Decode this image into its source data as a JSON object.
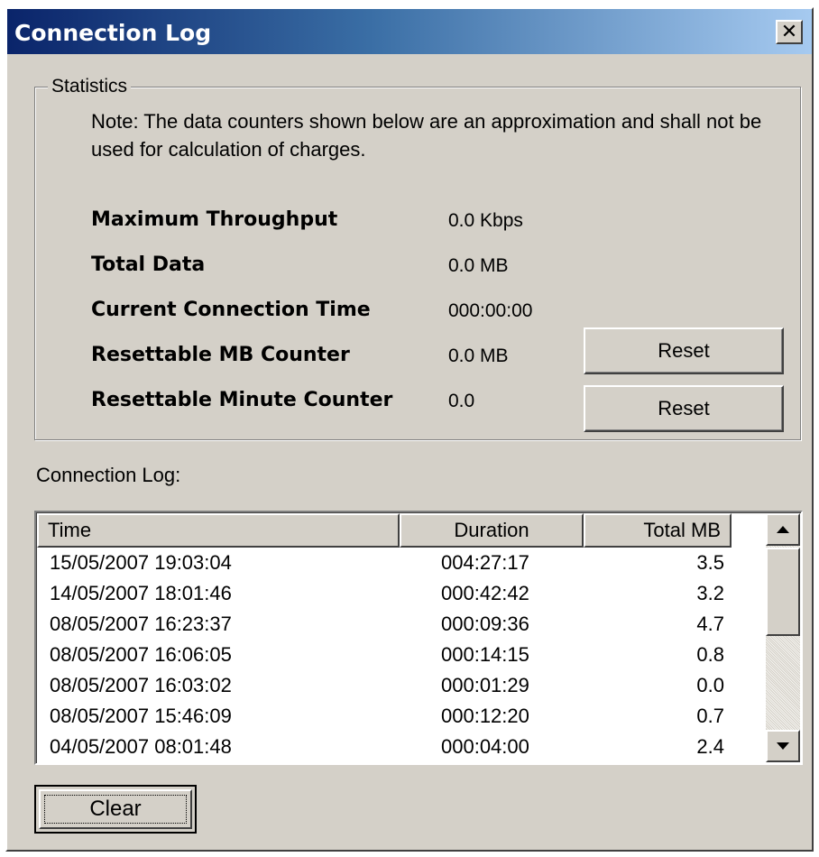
{
  "window": {
    "title": "Connection Log",
    "close_label": "✕"
  },
  "statistics": {
    "legend": "Statistics",
    "note": "Note: The data counters shown below are an approximation and shall not be used for calculation of charges.",
    "rows": [
      {
        "label": "Maximum Throughput",
        "value": "0.0 Kbps"
      },
      {
        "label": "Total Data",
        "value": "0.0 MB"
      },
      {
        "label": "Current Connection Time",
        "value": "000:00:00"
      },
      {
        "label": "Resettable MB Counter",
        "value": "0.0 MB"
      },
      {
        "label": "Resettable Minute Counter",
        "value": "0.0"
      }
    ],
    "reset_label": "Reset"
  },
  "log": {
    "label": "Connection Log:",
    "columns": [
      "Time",
      "Duration",
      "Total MB"
    ],
    "rows": [
      [
        "15/05/2007 19:03:04",
        "004:27:17",
        "3.5"
      ],
      [
        "14/05/2007 18:01:46",
        "000:42:42",
        "3.2"
      ],
      [
        "08/05/2007 16:23:37",
        "000:09:36",
        "4.7"
      ],
      [
        "08/05/2007 16:06:05",
        "000:14:15",
        "0.8"
      ],
      [
        "08/05/2007 16:03:02",
        "000:01:29",
        "0.0"
      ],
      [
        "08/05/2007 15:46:09",
        "000:12:20",
        "0.7"
      ],
      [
        "04/05/2007 08:01:48",
        "000:04:00",
        "2.4"
      ]
    ]
  },
  "clear_label": "Clear",
  "icons": {
    "close": "close-icon",
    "scroll_up": "scroll-up-arrow-icon",
    "scroll_down": "scroll-down-arrow-icon"
  }
}
